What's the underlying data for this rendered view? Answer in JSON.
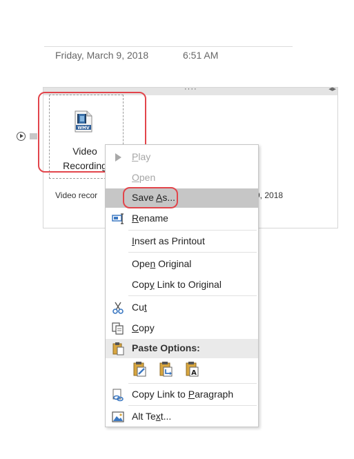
{
  "note": {
    "date": "Friday, March 9, 2018",
    "time": "6:51 AM"
  },
  "attachment": {
    "icon": "wmv-file-icon",
    "label_line1": "Video",
    "label_line2": "Recording",
    "caption_left": "Video recor",
    "caption_right": "9, 2018"
  },
  "context_menu": {
    "play": {
      "mnemonic": "P",
      "rest": "lay"
    },
    "open": {
      "mnemonic": "O",
      "rest": "pen"
    },
    "save_as": {
      "pre": "Save ",
      "mnemonic": "A",
      "post": "s..."
    },
    "rename": {
      "mnemonic": "R",
      "rest": "ename"
    },
    "insert_printout": {
      "mnemonic": "I",
      "rest": "nsert as Printout"
    },
    "open_original": {
      "pre": "Ope",
      "mnemonic": "n",
      "post": " Original"
    },
    "copy_link_original": {
      "pre": "Cop",
      "mnemonic": "y",
      "post": " Link to Original"
    },
    "cut": {
      "pre": "Cu",
      "mnemonic": "t",
      "post": ""
    },
    "copy": {
      "mnemonic": "C",
      "rest": "opy"
    },
    "paste_options": "Paste Options:",
    "copy_link_paragraph": {
      "pre": "Copy Link to ",
      "mnemonic": "P",
      "post": "aragraph"
    },
    "alt_text": {
      "pre": "Alt Te",
      "mnemonic": "x",
      "post": "t..."
    }
  },
  "colors": {
    "highlight": "#e2444a",
    "menu_hover": "#c6c6c6",
    "icon_blue": "#3b78c2",
    "icon_gold": "#d8a640"
  }
}
